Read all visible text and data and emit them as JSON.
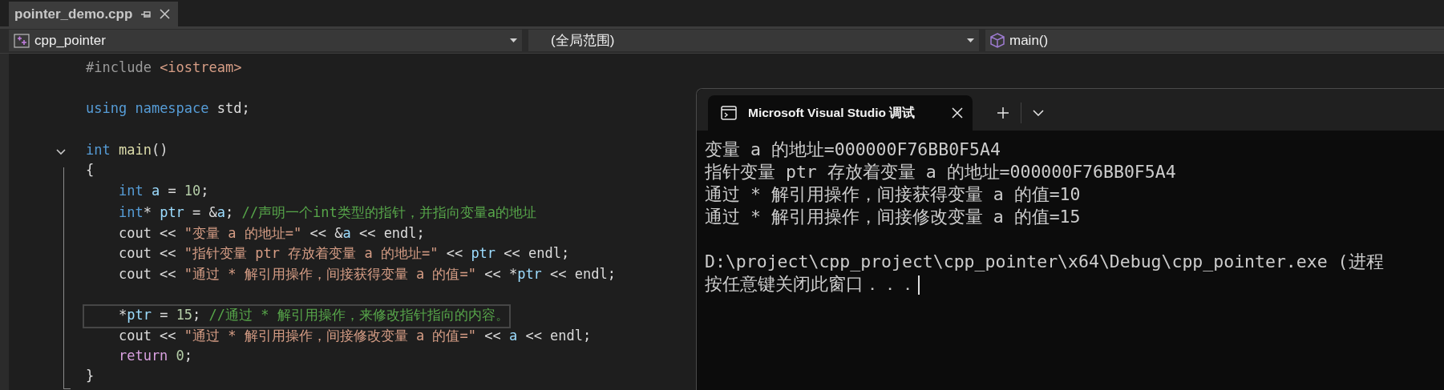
{
  "editor_tabs": [
    {
      "title": "pointer_demo.cpp",
      "selected": true
    }
  ],
  "nav": {
    "project": "cpp_pointer",
    "scope": "(全局范围)",
    "member": "main()"
  },
  "code": {
    "lines": [
      {
        "kind": "code",
        "tokens": [
          {
            "kind": "pp",
            "text": "#include "
          },
          {
            "kind": "str",
            "text": "<iostream>"
          }
        ]
      },
      {
        "kind": "blank"
      },
      {
        "kind": "code",
        "tokens": [
          {
            "kind": "kw",
            "text": "using "
          },
          {
            "kind": "kw",
            "text": "namespace"
          },
          {
            "kind": "txt",
            "text": " std;"
          }
        ]
      },
      {
        "kind": "blank"
      },
      {
        "kind": "code",
        "expanded": true,
        "tokens": [
          {
            "kind": "kw",
            "text": "int"
          },
          {
            "kind": "fn",
            "text": " main"
          },
          {
            "kind": "txt",
            "text": "()"
          }
        ]
      },
      {
        "kind": "code",
        "tokens": [
          {
            "kind": "txt",
            "text": "{"
          }
        ]
      },
      {
        "kind": "code",
        "tokens": [
          {
            "kind": "kw",
            "text": "    int"
          },
          {
            "kind": "var",
            "text": " a"
          },
          {
            "kind": "txt",
            "text": " = "
          },
          {
            "kind": "num",
            "text": "10"
          },
          {
            "kind": "txt",
            "text": ";"
          }
        ]
      },
      {
        "kind": "code",
        "tokens": [
          {
            "kind": "kw",
            "text": "    int"
          },
          {
            "kind": "txt",
            "text": "* "
          },
          {
            "kind": "var",
            "text": "ptr"
          },
          {
            "kind": "txt",
            "text": " = &"
          },
          {
            "kind": "var",
            "text": "a"
          },
          {
            "kind": "txt",
            "text": "; "
          },
          {
            "kind": "cmt",
            "text": "//声明一个int类型的指针，并指向变量a的地址"
          }
        ]
      },
      {
        "kind": "code",
        "tokens": [
          {
            "kind": "txt",
            "text": "    cout << "
          },
          {
            "kind": "str",
            "text": "\"变量 a 的地址=\""
          },
          {
            "kind": "txt",
            "text": " << &"
          },
          {
            "kind": "var",
            "text": "a"
          },
          {
            "kind": "txt",
            "text": " << endl;"
          }
        ]
      },
      {
        "kind": "code",
        "tokens": [
          {
            "kind": "txt",
            "text": "    cout << "
          },
          {
            "kind": "str",
            "text": "\"指针变量 ptr 存放着变量 a 的地址=\""
          },
          {
            "kind": "txt",
            "text": " << "
          },
          {
            "kind": "var",
            "text": "ptr"
          },
          {
            "kind": "txt",
            "text": " << endl;"
          }
        ]
      },
      {
        "kind": "code",
        "tokens": [
          {
            "kind": "txt",
            "text": "    cout << "
          },
          {
            "kind": "str",
            "text": "\"通过 * 解引用操作，间接获得变量 a 的值=\""
          },
          {
            "kind": "txt",
            "text": " << *"
          },
          {
            "kind": "var",
            "text": "ptr"
          },
          {
            "kind": "txt",
            "text": " << endl;"
          }
        ]
      },
      {
        "kind": "blank"
      },
      {
        "kind": "code",
        "current": true,
        "tokens": [
          {
            "kind": "txt",
            "text": "    *"
          },
          {
            "kind": "var",
            "text": "ptr"
          },
          {
            "kind": "txt",
            "text": " = "
          },
          {
            "kind": "num",
            "text": "15"
          },
          {
            "kind": "txt",
            "text": "; "
          },
          {
            "kind": "cmt",
            "text": "//通过 * 解引用操作，来修改指针指向的内容。"
          }
        ]
      },
      {
        "kind": "code",
        "tokens": [
          {
            "kind": "txt",
            "text": "    cout << "
          },
          {
            "kind": "str",
            "text": "\"通过 * 解引用操作，间接修改变量 a 的值=\""
          },
          {
            "kind": "txt",
            "text": " << "
          },
          {
            "kind": "var",
            "text": "a"
          },
          {
            "kind": "txt",
            "text": " << endl;"
          }
        ]
      },
      {
        "kind": "code",
        "tokens": [
          {
            "kind": "ctl",
            "text": "    return"
          },
          {
            "kind": "num",
            "text": " 0"
          },
          {
            "kind": "txt",
            "text": ";"
          }
        ]
      },
      {
        "kind": "code",
        "tokens": [
          {
            "kind": "txt",
            "text": "}"
          }
        ]
      }
    ]
  },
  "console": {
    "tab_title": "Microsoft Visual Studio 调试",
    "cursor": true,
    "output_blocks": [
      [
        "变量 a 的地址=000000F76BB0F5A4",
        "指针变量 ptr 存放着变量 a 的地址=000000F76BB0F5A4",
        "通过 * 解引用操作，间接获得变量 a 的值=10",
        "通过 * 解引用操作，间接修改变量 a 的值=15"
      ],
      [
        "D:\\project\\cpp_project\\cpp_pointer\\x64\\Debug\\cpp_pointer.exe (进程",
        "按任意键关闭此窗口．．．"
      ]
    ]
  }
}
